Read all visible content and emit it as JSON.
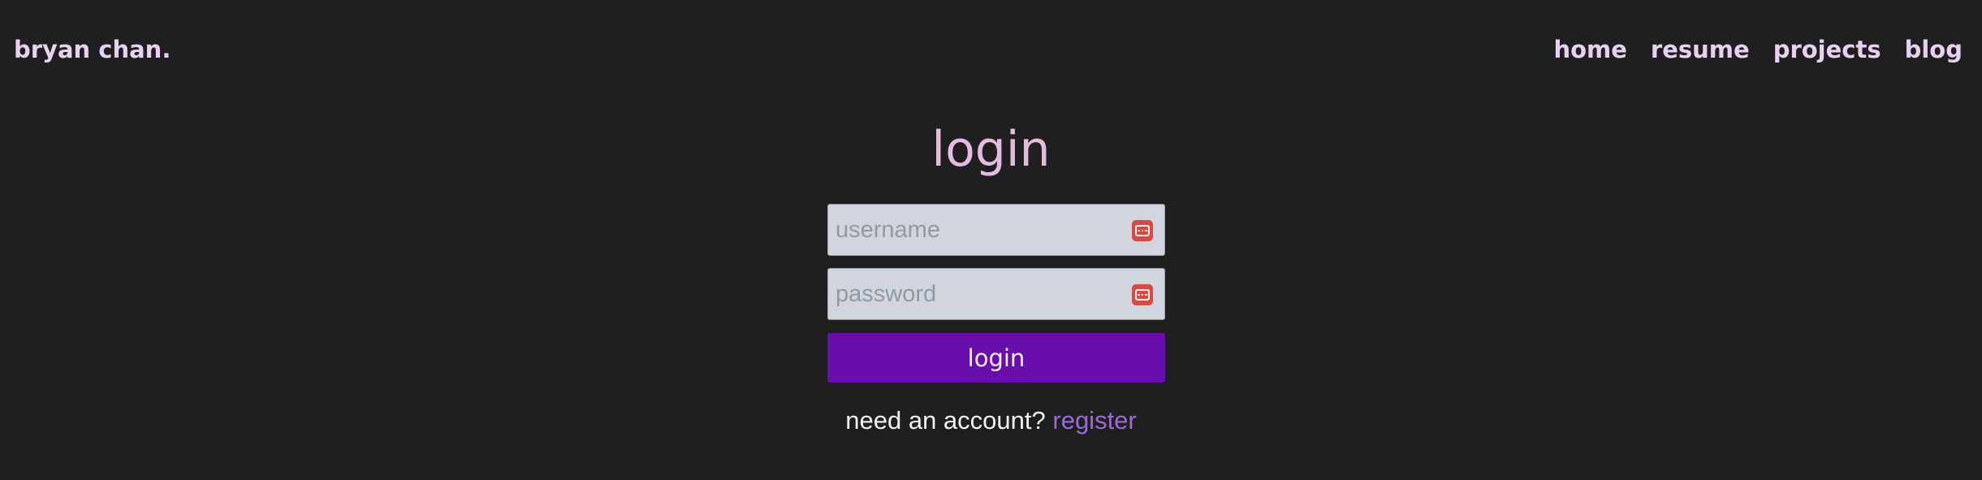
{
  "header": {
    "brand": "bryan chan.",
    "nav": [
      {
        "label": "home"
      },
      {
        "label": "resume"
      },
      {
        "label": "projects"
      },
      {
        "label": "blog"
      }
    ]
  },
  "login_form": {
    "title": "login",
    "username": {
      "placeholder": "username",
      "value": ""
    },
    "password": {
      "placeholder": "password",
      "value": ""
    },
    "submit_label": "login",
    "password_manager_icon": "password-manager-icon",
    "footer": {
      "prompt": "need an account?",
      "link_label": "register"
    }
  },
  "colors": {
    "background": "#1f1f1f",
    "nav_text": "#e8d0f0",
    "title": "#e3bde0",
    "button": "#6a0dad",
    "link": "#9b6bd6",
    "icon": "#e0473f"
  }
}
